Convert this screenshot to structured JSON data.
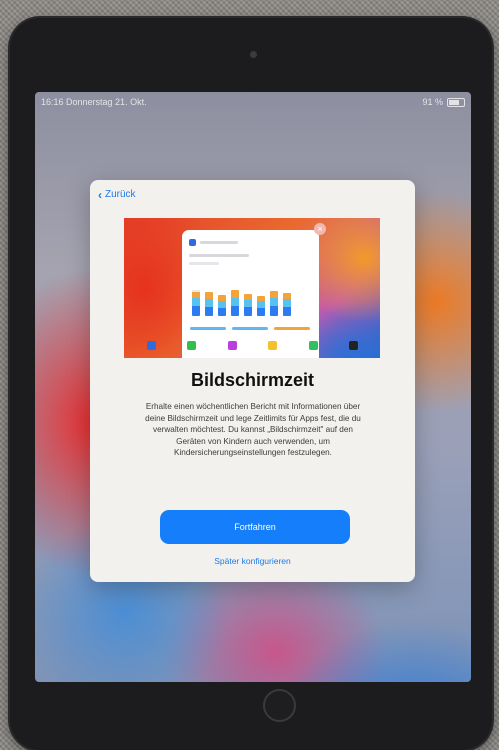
{
  "status_bar": {
    "time_date": "16:16  Donnerstag 21. Okt.",
    "right_indicator": "91 %"
  },
  "back_button": {
    "label": "Zurück",
    "icon": "chevron-left-icon"
  },
  "illustration": {
    "close_icon": "close-icon",
    "dock_colors": [
      "#2e6be0",
      "#2fbf4a",
      "#b93ee0",
      "#f2c22e",
      "#30c060",
      "#222222"
    ]
  },
  "title": "Bildschirmzeit",
  "description": "Erhalte einen wöchentlichen Bericht mit Informationen über deine Bildschirmzeit und lege Zeitlimits für Apps fest, die du verwalten möchtest. Du kannst „Bildschirmzeit\" auf den Geräten von Kindern auch verwenden, um Kindersicherungseinstellungen festzulegen.",
  "primary_button": {
    "label": "Fortfahren"
  },
  "secondary_button": {
    "label": "Später konfigurieren"
  },
  "colors": {
    "accent": "#157efb",
    "sheet_background": "#f2f1ee"
  }
}
